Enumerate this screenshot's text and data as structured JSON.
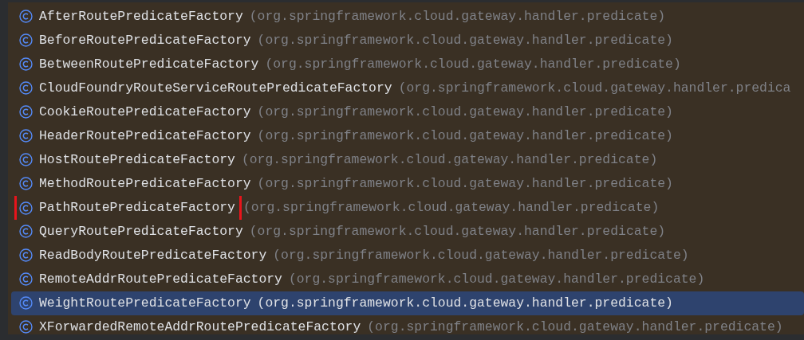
{
  "items": [
    {
      "name": "AfterRoutePredicateFactory",
      "package": "(org.springframework.cloud.gateway.handler.predicate)",
      "selected": false,
      "highlighted": false
    },
    {
      "name": "BeforeRoutePredicateFactory",
      "package": "(org.springframework.cloud.gateway.handler.predicate)",
      "selected": false,
      "highlighted": false
    },
    {
      "name": "BetweenRoutePredicateFactory",
      "package": "(org.springframework.cloud.gateway.handler.predicate)",
      "selected": false,
      "highlighted": false
    },
    {
      "name": "CloudFoundryRouteServiceRoutePredicateFactory",
      "package": "(org.springframework.cloud.gateway.handler.predica",
      "selected": false,
      "highlighted": false
    },
    {
      "name": "CookieRoutePredicateFactory",
      "package": "(org.springframework.cloud.gateway.handler.predicate)",
      "selected": false,
      "highlighted": false
    },
    {
      "name": "HeaderRoutePredicateFactory",
      "package": "(org.springframework.cloud.gateway.handler.predicate)",
      "selected": false,
      "highlighted": false
    },
    {
      "name": "HostRoutePredicateFactory",
      "package": "(org.springframework.cloud.gateway.handler.predicate)",
      "selected": false,
      "highlighted": false
    },
    {
      "name": "MethodRoutePredicateFactory",
      "package": "(org.springframework.cloud.gateway.handler.predicate)",
      "selected": false,
      "highlighted": false
    },
    {
      "name": "PathRoutePredicateFactory",
      "package": "(org.springframework.cloud.gateway.handler.predicate)",
      "selected": false,
      "highlighted": true
    },
    {
      "name": "QueryRoutePredicateFactory",
      "package": "(org.springframework.cloud.gateway.handler.predicate)",
      "selected": false,
      "highlighted": false
    },
    {
      "name": "ReadBodyRoutePredicateFactory",
      "package": "(org.springframework.cloud.gateway.handler.predicate)",
      "selected": false,
      "highlighted": false
    },
    {
      "name": "RemoteAddrRoutePredicateFactory",
      "package": "(org.springframework.cloud.gateway.handler.predicate)",
      "selected": false,
      "highlighted": false
    },
    {
      "name": "WeightRoutePredicateFactory",
      "package": "(org.springframework.cloud.gateway.handler.predicate)",
      "selected": true,
      "highlighted": false
    },
    {
      "name": "XForwardedRemoteAddrRoutePredicateFactory",
      "package": "(org.springframework.cloud.gateway.handler.predicate)",
      "selected": false,
      "highlighted": false
    }
  ]
}
